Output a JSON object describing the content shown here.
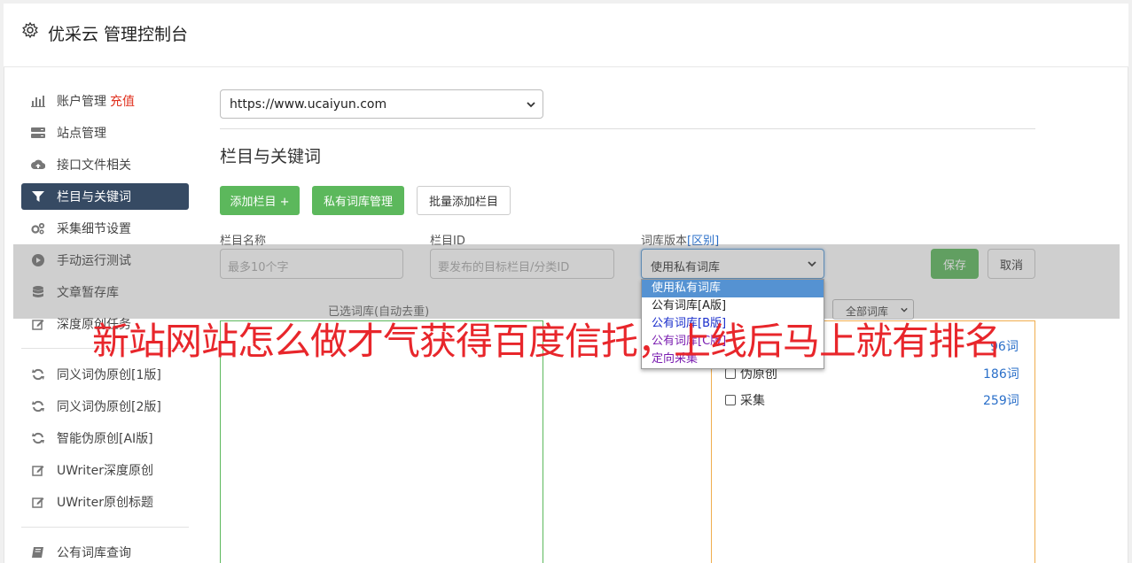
{
  "header": {
    "title": "优采云 管理控制台"
  },
  "sidebar": {
    "items": [
      {
        "label": "账户管理",
        "badge": "充值"
      },
      {
        "label": "站点管理"
      },
      {
        "label": "接口文件相关"
      },
      {
        "label": "栏目与关键词"
      },
      {
        "label": "采集细节设置"
      },
      {
        "label": "手动运行测试"
      },
      {
        "label": "文章暂存库"
      },
      {
        "label": "深度原创任务"
      },
      {
        "label": "同义词伪原创[1版]"
      },
      {
        "label": "同义词伪原创[2版]"
      },
      {
        "label": "智能伪原创[AI版]"
      },
      {
        "label": "UWriter深度原创"
      },
      {
        "label": "UWriter原创标题"
      },
      {
        "label": "公有词库查询"
      }
    ]
  },
  "site_select": {
    "value": "https://www.ucaiyun.com"
  },
  "section": {
    "title": "栏目与关键词"
  },
  "toolbar": {
    "add_column": "添加栏目 +",
    "private_lib": "私有词库管理",
    "batch_add": "批量添加栏目"
  },
  "form": {
    "name_label": "栏目名称",
    "name_placeholder": "最多10个字",
    "id_label": "栏目ID",
    "id_placeholder": "要发布的目标栏目/分类ID",
    "version_label": "词库版本",
    "version_link": "[区别]",
    "version_value": "使用私有词库",
    "save": "保存",
    "cancel": "取消"
  },
  "dropdown": {
    "options": [
      "使用私有词库",
      "公有词库[A版]",
      "公有词库[B版]",
      "公有词库[C版]",
      "定向采集"
    ]
  },
  "libraries": {
    "selected_label": "已选词库(自动去重)",
    "filter_value": "全部词库",
    "rows": [
      {
        "name": "",
        "count": "96词"
      },
      {
        "name": "伪原创",
        "count": "186词"
      },
      {
        "name": "采集",
        "count": "259词"
      }
    ]
  },
  "banner": {
    "text": "新站网站怎么做才气获得百度信托，上线后马上就有排名"
  },
  "colors": {
    "active_nav": "#364a63",
    "green": "#5cb85c",
    "orange": "#f0ad4e",
    "banner_red": "#e8262b"
  }
}
